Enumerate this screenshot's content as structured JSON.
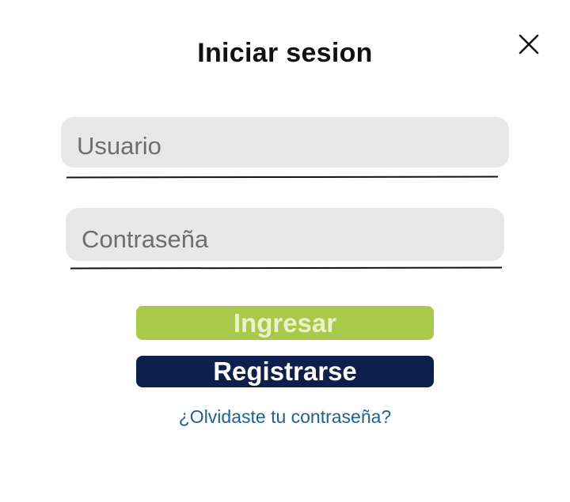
{
  "dialog": {
    "title": "Iniciar sesion",
    "close_icon": "close-icon"
  },
  "form": {
    "username": {
      "placeholder": "Usuario",
      "value": ""
    },
    "password": {
      "placeholder": "Contraseña",
      "value": ""
    },
    "login_label": "Ingresar",
    "register_label": "Registrarse",
    "forgot_link": "¿Olvidaste tu contraseña?"
  },
  "colors": {
    "login_button": "#a8c94a",
    "login_text": "#e9f2cf",
    "register_button": "#0e1f4c",
    "link": "#1d5fa6",
    "field_background": "#e8e8e8"
  }
}
